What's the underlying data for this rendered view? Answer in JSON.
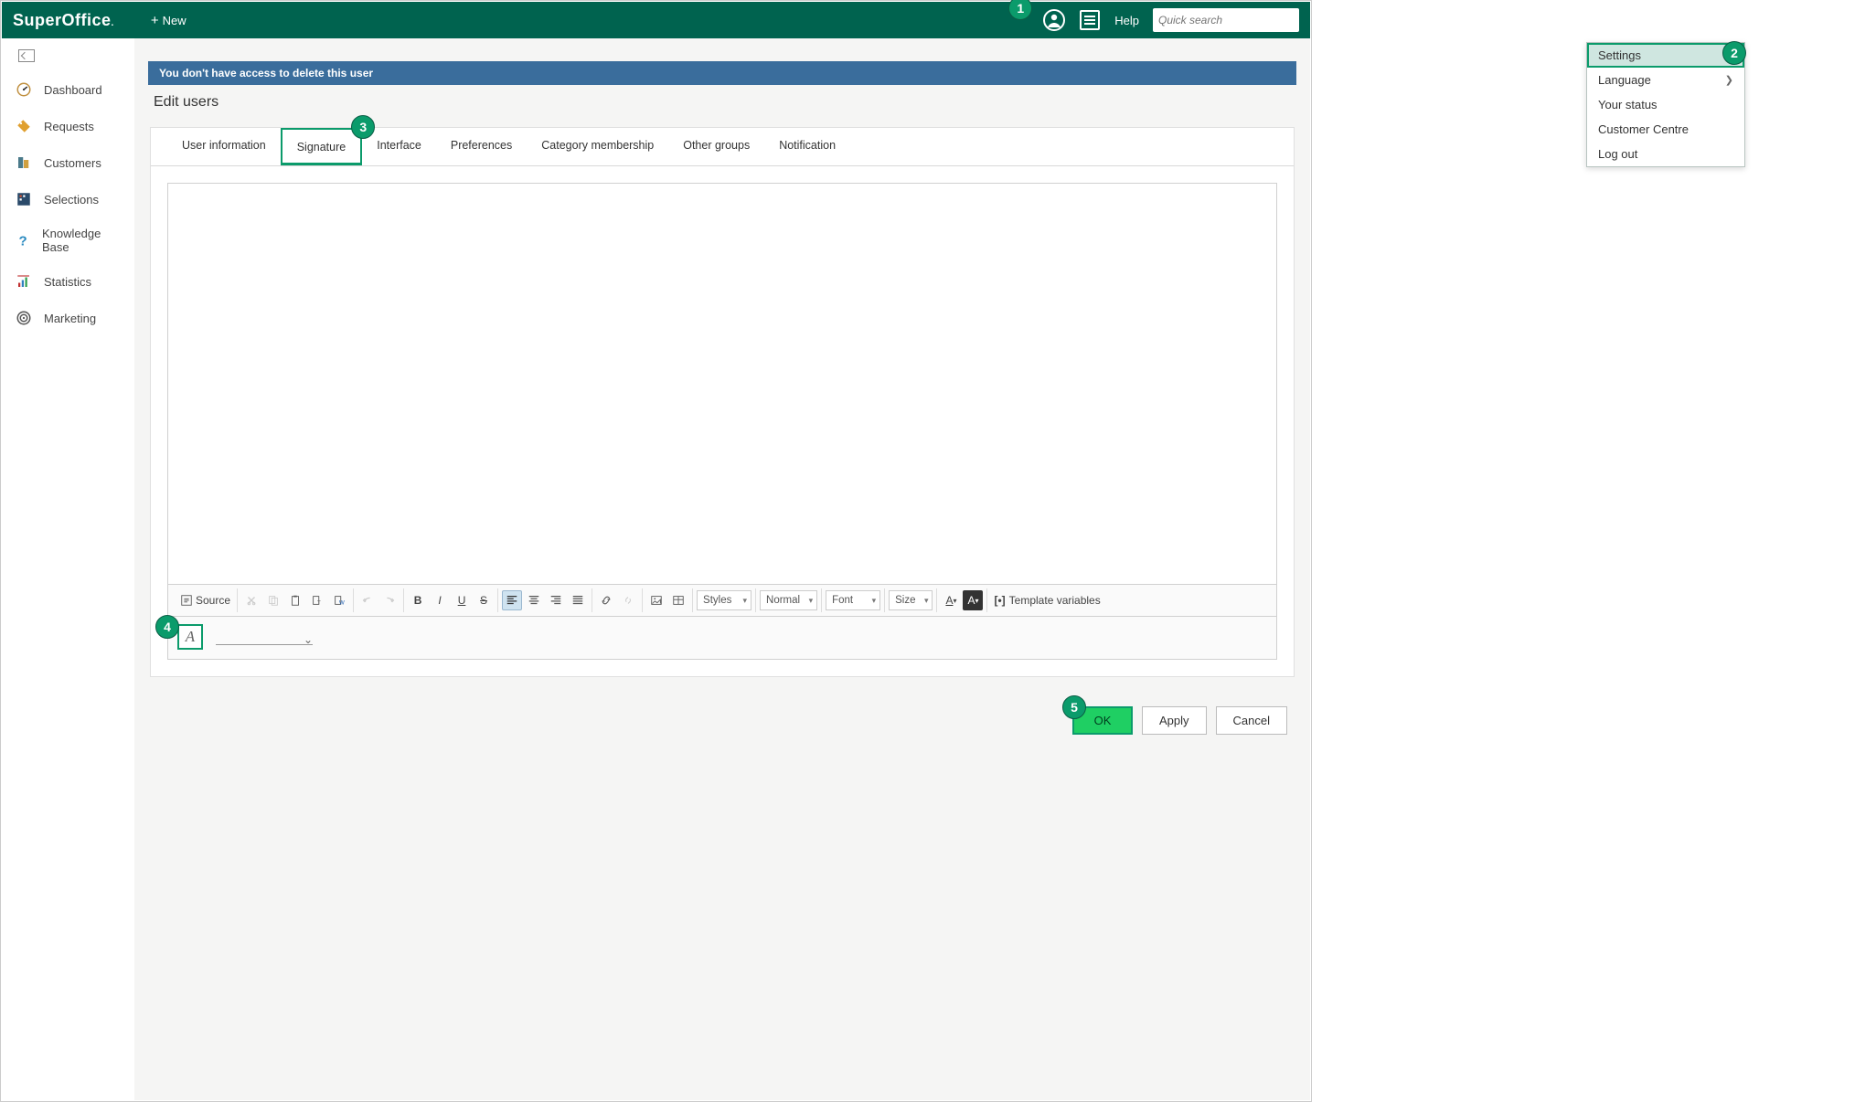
{
  "topbar": {
    "logo": "SuperOffice",
    "new_label": "New",
    "help_label": "Help",
    "search_placeholder": "Quick search"
  },
  "dropdown": {
    "items": [
      {
        "label": "Settings",
        "selected": true,
        "has_submenu": false
      },
      {
        "label": "Language",
        "selected": false,
        "has_submenu": true
      },
      {
        "label": "Your status",
        "selected": false,
        "has_submenu": false
      },
      {
        "label": "Customer Centre",
        "selected": false,
        "has_submenu": false
      },
      {
        "label": "Log out",
        "selected": false,
        "has_submenu": false
      }
    ]
  },
  "sidebar": {
    "items": [
      {
        "label": "Dashboard",
        "icon": "gauge"
      },
      {
        "label": "Requests",
        "icon": "tag"
      },
      {
        "label": "Customers",
        "icon": "building"
      },
      {
        "label": "Selections",
        "icon": "grid"
      },
      {
        "label": "Knowledge Base",
        "icon": "question"
      },
      {
        "label": "Statistics",
        "icon": "bars"
      },
      {
        "label": "Marketing",
        "icon": "target"
      }
    ]
  },
  "alert": {
    "text": "You don't have access to delete this user"
  },
  "page": {
    "title": "Edit users"
  },
  "tabs": [
    {
      "label": "User information",
      "active": false
    },
    {
      "label": "Signature",
      "active": true
    },
    {
      "label": "Interface",
      "active": false
    },
    {
      "label": "Preferences",
      "active": false
    },
    {
      "label": "Category membership",
      "active": false
    },
    {
      "label": "Other groups",
      "active": false
    },
    {
      "label": "Notification",
      "active": false
    }
  ],
  "toolbar": {
    "source_label": "Source",
    "styles_label": "Styles",
    "format_label": "Normal",
    "font_label": "Font",
    "size_label": "Size",
    "templatevars_label": "Template variables"
  },
  "buttons": {
    "ok": "OK",
    "apply": "Apply",
    "cancel": "Cancel"
  },
  "callouts": {
    "c1": "1",
    "c2": "2",
    "c3": "3",
    "c4": "4",
    "c5": "5"
  }
}
